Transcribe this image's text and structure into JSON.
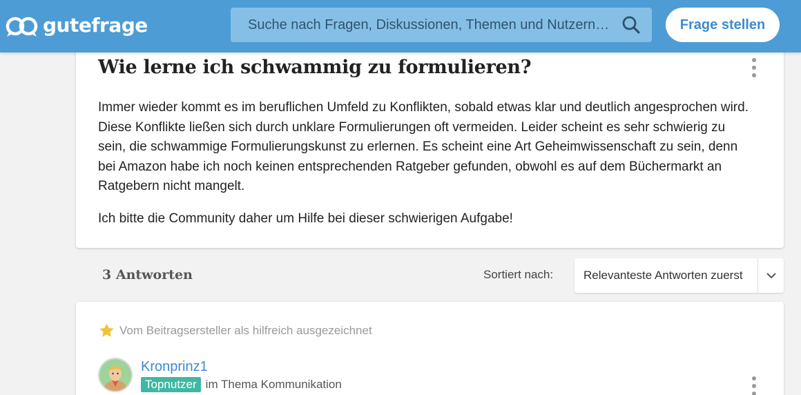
{
  "header": {
    "logo_text": "gutefrage",
    "search_placeholder": "Suche nach Fragen, Diskussionen, Themen und Nutzern…",
    "ask_button": "Frage stellen",
    "brand_color": "#4d9cd6"
  },
  "question": {
    "title": "Wie lerne ich schwammig zu formulieren?",
    "paragraphs": [
      "Immer wieder kommt es im beruflichen Umfeld zu Konflikten, sobald etwas klar und deutlich angesprochen wird. Diese Konflikte ließen sich durch unklare Formulierungen oft vermeiden. Leider scheint es sehr schwierig zu sein, die schwammige Formulierungskunst zu erlernen. Es scheint eine Art Geheimwissenschaft zu sein, denn bei Amazon habe ich noch keinen entsprechenden Ratgeber gefunden, obwohl es auf dem Büchermarkt an Ratgebern nicht mangelt.",
      "Ich bitte die Community daher um Hilfe bei dieser schwierigen Aufgabe!"
    ]
  },
  "answers_bar": {
    "count_label": "3 Antworten",
    "sort_label": "Sortiert nach:",
    "sort_value": "Relevanteste Antworten zuerst"
  },
  "answer": {
    "helpful_text": "Vom Beitragsersteller als hilfreich ausgezeichnet",
    "author": "Kronprinz1",
    "badge": "Topnutzer",
    "topic": "im Thema Kommunikation",
    "badge_color": "#3fb8a3"
  },
  "icons": [
    "logo-icon",
    "search-icon",
    "more-options-icon",
    "chevron-down-icon",
    "star-icon",
    "avatar"
  ]
}
